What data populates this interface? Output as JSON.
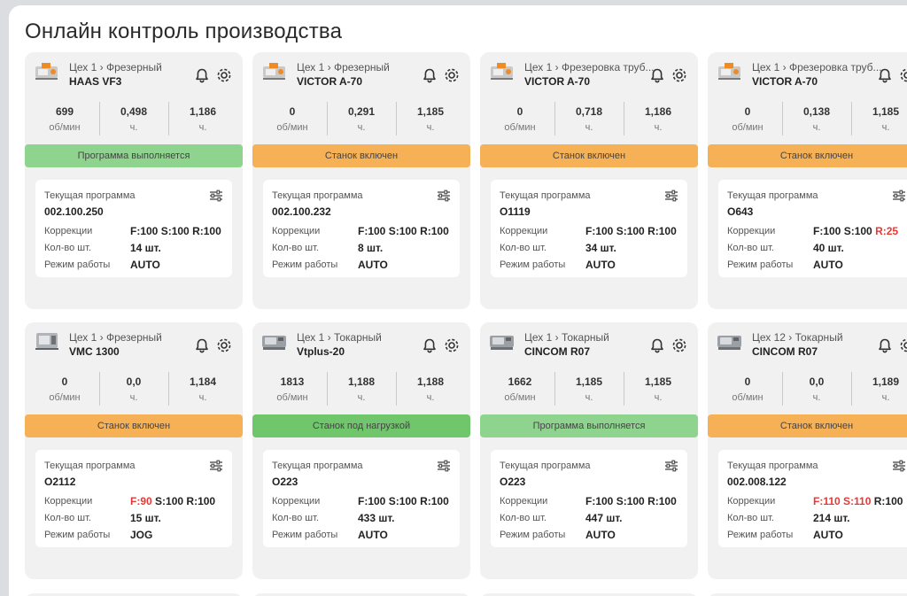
{
  "page_title": "Онлайн контроль производства",
  "cards": [
    {
      "workshop": "Цех 1 › Фрезерный",
      "model": "HAAS VF3",
      "icon": "mill-icon",
      "metrics": [
        {
          "value": "699",
          "unit": "об/мин"
        },
        {
          "value": "0,498",
          "unit": "ч."
        },
        {
          "value": "1,186",
          "unit": "ч."
        }
      ],
      "status": "Программа выполняется",
      "status_color": "#8fd48e",
      "program_label": "Текущая программа",
      "program": "002.100.250",
      "corr_label": "Коррекции",
      "corr_f": "F:100",
      "corr_s": "S:100",
      "corr_r": "R:100",
      "corr_f_red": false,
      "corr_s_red": false,
      "corr_r_red": false,
      "qty_label": "Кол-во шт.",
      "qty": "14 шт.",
      "mode_label": "Режим работы",
      "mode": "AUTO"
    },
    {
      "workshop": "Цех 1 › Фрезерный",
      "model": "VICTOR A-70",
      "icon": "mill-icon",
      "metrics": [
        {
          "value": "0",
          "unit": "об/мин"
        },
        {
          "value": "0,291",
          "unit": "ч."
        },
        {
          "value": "1,185",
          "unit": "ч."
        }
      ],
      "status": "Станок включен",
      "status_color": "#f6b055",
      "program_label": "Текущая программа",
      "program": "002.100.232",
      "corr_label": "Коррекции",
      "corr_f": "F:100",
      "corr_s": "S:100",
      "corr_r": "R:100",
      "corr_f_red": false,
      "corr_s_red": false,
      "corr_r_red": false,
      "qty_label": "Кол-во шт.",
      "qty": "8 шт.",
      "mode_label": "Режим работы",
      "mode": "AUTO"
    },
    {
      "workshop": "Цех 1 › Фрезеровка труб...",
      "model": "VICTOR A-70",
      "icon": "mill-icon",
      "metrics": [
        {
          "value": "0",
          "unit": "об/мин"
        },
        {
          "value": "0,718",
          "unit": "ч."
        },
        {
          "value": "1,186",
          "unit": "ч."
        }
      ],
      "status": "Станок включен",
      "status_color": "#f6b055",
      "program_label": "Текущая программа",
      "program": "O1119",
      "corr_label": "Коррекции",
      "corr_f": "F:100",
      "corr_s": "S:100",
      "corr_r": "R:100",
      "corr_f_red": false,
      "corr_s_red": false,
      "corr_r_red": false,
      "qty_label": "Кол-во шт.",
      "qty": "34 шт.",
      "mode_label": "Режим работы",
      "mode": "AUTO"
    },
    {
      "workshop": "Цех 1 › Фрезеровка труб...",
      "model": "VICTOR A-70",
      "icon": "mill-icon",
      "metrics": [
        {
          "value": "0",
          "unit": "об/мин"
        },
        {
          "value": "0,138",
          "unit": "ч."
        },
        {
          "value": "1,185",
          "unit": "ч."
        }
      ],
      "status": "Станок включен",
      "status_color": "#f6b055",
      "program_label": "Текущая программа",
      "program": "O643",
      "corr_label": "Коррекции",
      "corr_f": "F:100",
      "corr_s": "S:100",
      "corr_r": "R:25",
      "corr_f_red": false,
      "corr_s_red": false,
      "corr_r_red": true,
      "qty_label": "Кол-во шт.",
      "qty": "40 шт.",
      "mode_label": "Режим работы",
      "mode": "AUTO"
    },
    {
      "workshop": "Цех 1 › Фрезерный",
      "model": "VMC 1300",
      "icon": "vmc-icon",
      "metrics": [
        {
          "value": "0",
          "unit": "об/мин"
        },
        {
          "value": "0,0",
          "unit": "ч."
        },
        {
          "value": "1,184",
          "unit": "ч."
        }
      ],
      "status": "Станок включен",
      "status_color": "#f6b055",
      "program_label": "Текущая программа",
      "program": "O2112",
      "corr_label": "Коррекции",
      "corr_f": "F:90",
      "corr_s": "S:100",
      "corr_r": "R:100",
      "corr_f_red": true,
      "corr_s_red": false,
      "corr_r_red": false,
      "qty_label": "Кол-во шт.",
      "qty": "15 шт.",
      "mode_label": "Режим работы",
      "mode": "JOG"
    },
    {
      "workshop": "Цех 1 › Токарный",
      "model": "Vtplus-20",
      "icon": "lathe-icon",
      "metrics": [
        {
          "value": "1813",
          "unit": "об/мин"
        },
        {
          "value": "1,188",
          "unit": "ч."
        },
        {
          "value": "1,188",
          "unit": "ч."
        }
      ],
      "status": "Станок под нагрузкой",
      "status_color": "#6fc66b",
      "program_label": "Текущая программа",
      "program": "O223",
      "corr_label": "Коррекции",
      "corr_f": "F:100",
      "corr_s": "S:100",
      "corr_r": "R:100",
      "corr_f_red": false,
      "corr_s_red": false,
      "corr_r_red": false,
      "qty_label": "Кол-во шт.",
      "qty": "433 шт.",
      "mode_label": "Режим работы",
      "mode": "AUTO"
    },
    {
      "workshop": "Цех 1 › Токарный",
      "model": "CINCOM R07",
      "icon": "lathe-icon",
      "metrics": [
        {
          "value": "1662",
          "unit": "об/мин"
        },
        {
          "value": "1,185",
          "unit": "ч."
        },
        {
          "value": "1,185",
          "unit": "ч."
        }
      ],
      "status": "Программа выполняется",
      "status_color": "#8fd48e",
      "program_label": "Текущая программа",
      "program": "O223",
      "corr_label": "Коррекции",
      "corr_f": "F:100",
      "corr_s": "S:100",
      "corr_r": "R:100",
      "corr_f_red": false,
      "corr_s_red": false,
      "corr_r_red": false,
      "qty_label": "Кол-во шт.",
      "qty": "447 шт.",
      "mode_label": "Режим работы",
      "mode": "AUTO"
    },
    {
      "workshop": "Цех 12 › Токарный",
      "model": "CINCOM R07",
      "icon": "lathe-icon",
      "metrics": [
        {
          "value": "0",
          "unit": "об/мин"
        },
        {
          "value": "0,0",
          "unit": "ч."
        },
        {
          "value": "1,189",
          "unit": "ч."
        }
      ],
      "status": "Станок включен",
      "status_color": "#f6b055",
      "program_label": "Текущая программа",
      "program": "002.008.122",
      "corr_label": "Коррекции",
      "corr_f": "F:110",
      "corr_s": "S:110",
      "corr_r": "R:100",
      "corr_f_red": true,
      "corr_s_red": true,
      "corr_r_red": false,
      "qty_label": "Кол-во шт.",
      "qty": "214 шт.",
      "mode_label": "Режим работы",
      "mode": "AUTO"
    }
  ]
}
